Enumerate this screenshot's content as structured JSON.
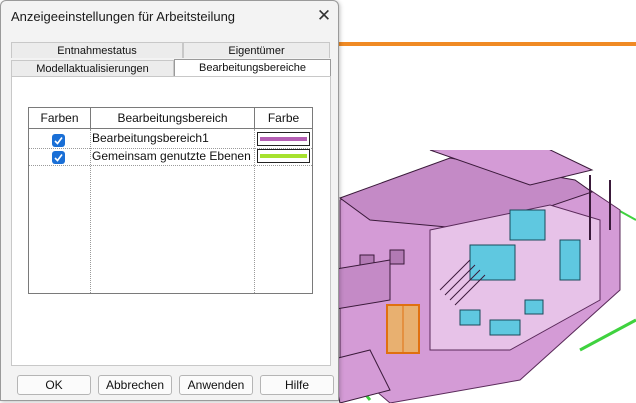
{
  "dialog": {
    "title": "Anzeigeeinstellungen für Arbeitsteilung",
    "close_glyph": "✕"
  },
  "tabs": {
    "row1": [
      "Entnahmestatus",
      "Eigentümer"
    ],
    "row2": [
      "Modellaktualisierungen",
      "Bearbeitungsbereiche"
    ],
    "active": "Bearbeitungsbereiche"
  },
  "table": {
    "headers": [
      "Farben",
      "Bearbeitungsbereich",
      "Farbe"
    ],
    "rows": [
      {
        "checked": true,
        "name": "Bearbeitungsbereich1",
        "color": "#b45fb4"
      },
      {
        "checked": true,
        "name": "Gemeinsam genutzte Ebenen",
        "color": "#a6e22e"
      }
    ]
  },
  "buttons": {
    "ok": "OK",
    "cancel": "Abbrechen",
    "apply": "Anwenden",
    "help": "Hilfe"
  },
  "colors": {
    "checkbox": "#1a6fd6",
    "model_fill": "#d49bd6",
    "model_glass": "#5fc8e0",
    "accent_orange": "#f08a24"
  }
}
